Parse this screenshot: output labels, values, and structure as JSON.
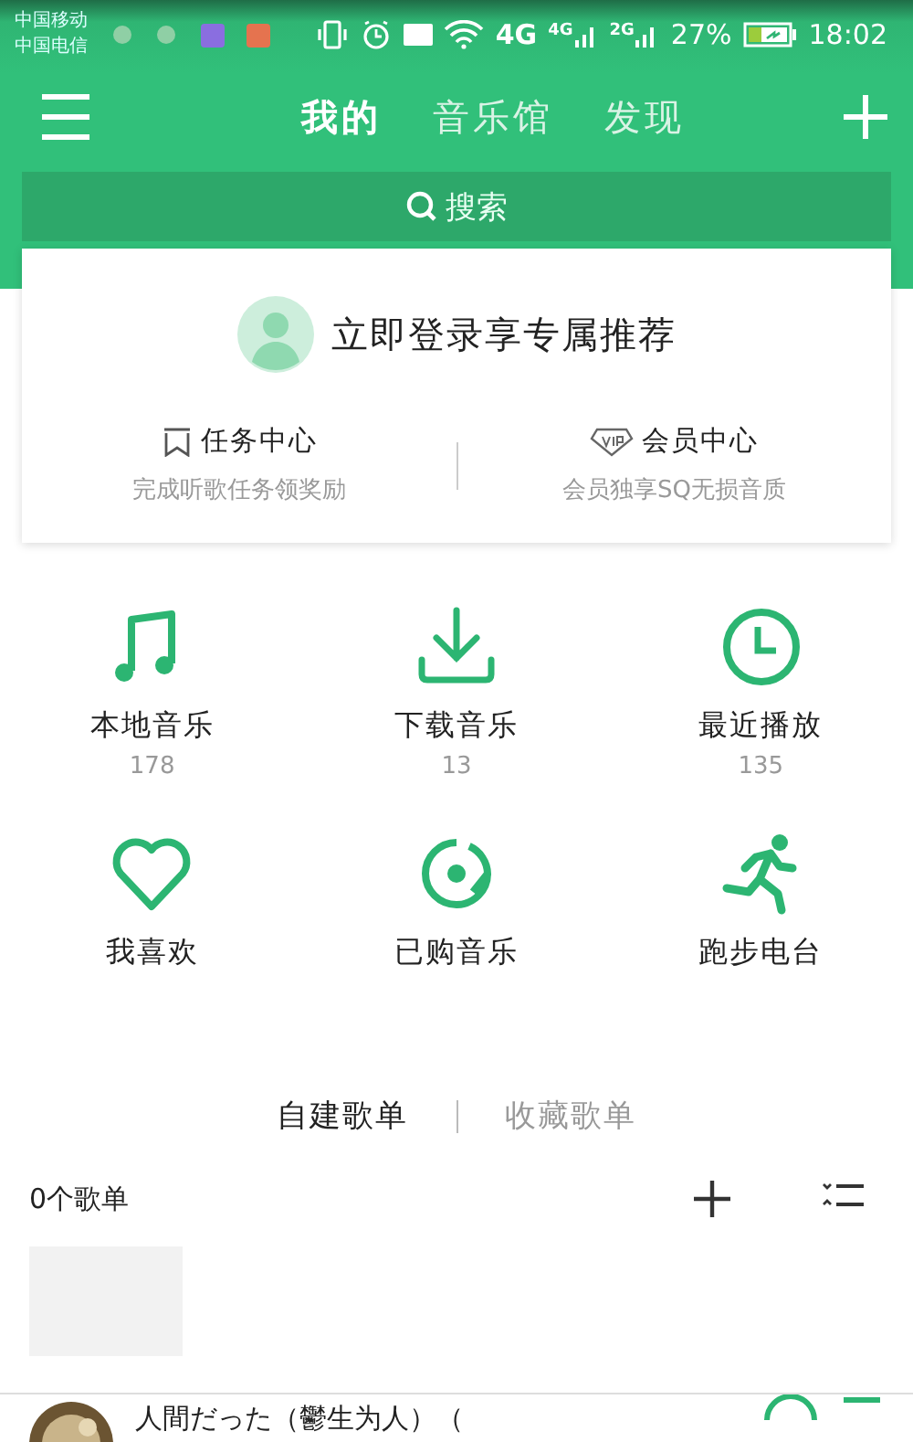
{
  "status_bar": {
    "carriers": [
      "中国移动",
      "中国电信"
    ],
    "network_4g": "4G",
    "network_4g_small": "4G",
    "network_2g": "2G",
    "battery": "27%",
    "time": "18:02"
  },
  "header": {
    "tabs": [
      {
        "label": "我的",
        "selected": true
      },
      {
        "label": "音乐馆",
        "selected": false
      },
      {
        "label": "发现",
        "selected": false
      }
    ]
  },
  "search": {
    "placeholder": "搜索"
  },
  "login_card": {
    "title": "立即登录享专属推荐",
    "links": [
      {
        "kind": "task",
        "label": "任务中心",
        "subtitle": "完成听歌任务领奖励"
      },
      {
        "kind": "vip",
        "label": "会员中心",
        "subtitle": "会员独享SQ无损音质"
      }
    ]
  },
  "shortcuts": [
    {
      "kind": "note",
      "label": "本地音乐",
      "count": "178"
    },
    {
      "kind": "download",
      "label": "下载音乐",
      "count": "13"
    },
    {
      "kind": "clock",
      "label": "最近播放",
      "count": "135"
    },
    {
      "kind": "heart",
      "label": "我喜欢"
    },
    {
      "kind": "disc",
      "label": "已购音乐"
    },
    {
      "kind": "runner",
      "label": "跑步电台"
    }
  ],
  "playlist_tabs": [
    {
      "label": "自建歌单",
      "selected": true
    },
    {
      "label": "收藏歌单",
      "selected": false
    }
  ],
  "playlist_count": "0个歌单",
  "player": {
    "title": "人間だった（鬱生为人）（"
  }
}
